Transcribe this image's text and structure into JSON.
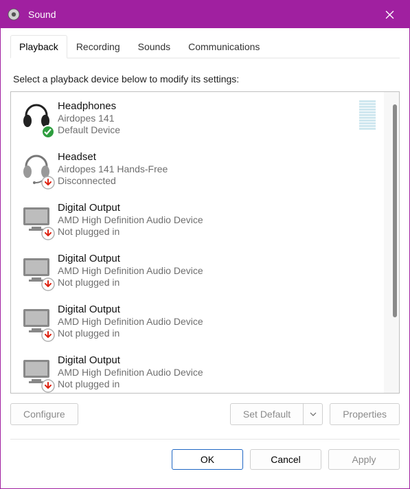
{
  "window": {
    "title": "Sound"
  },
  "tabs": [
    {
      "label": "Playback",
      "active": true
    },
    {
      "label": "Recording",
      "active": false
    },
    {
      "label": "Sounds",
      "active": false
    },
    {
      "label": "Communications",
      "active": false
    }
  ],
  "instruction": "Select a playback device below to modify its settings:",
  "devices": [
    {
      "icon": "headphones",
      "badge": "check",
      "name": "Headphones",
      "sub": "Airdopes 141",
      "status": "Default Device",
      "level": true
    },
    {
      "icon": "headset",
      "badge": "down-red",
      "name": "Headset",
      "sub": "Airdopes 141 Hands-Free",
      "status": "Disconnected",
      "level": false
    },
    {
      "icon": "monitor",
      "badge": "down-red",
      "name": "Digital Output",
      "sub": "AMD High Definition Audio Device",
      "status": "Not plugged in",
      "level": false
    },
    {
      "icon": "monitor",
      "badge": "down-red",
      "name": "Digital Output",
      "sub": "AMD High Definition Audio Device",
      "status": "Not plugged in",
      "level": false
    },
    {
      "icon": "monitor",
      "badge": "down-red",
      "name": "Digital Output",
      "sub": "AMD High Definition Audio Device",
      "status": "Not plugged in",
      "level": false
    },
    {
      "icon": "monitor",
      "badge": "down-red",
      "name": "Digital Output",
      "sub": "AMD High Definition Audio Device",
      "status": "Not plugged in",
      "level": false
    }
  ],
  "buttons": {
    "configure": "Configure",
    "set_default": "Set Default",
    "properties": "Properties",
    "ok": "OK",
    "cancel": "Cancel",
    "apply": "Apply"
  }
}
